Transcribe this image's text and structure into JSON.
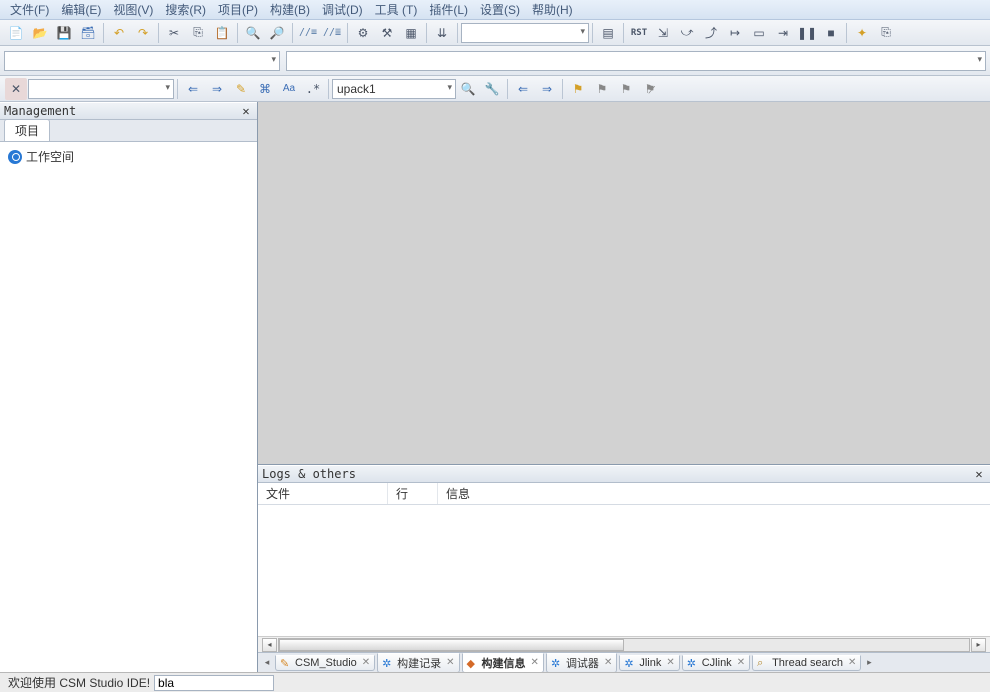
{
  "menubar": [
    "文件(F)",
    "编辑(E)",
    "视图(V)",
    "搜索(R)",
    "项目(P)",
    "构建(B)",
    "调试(D)",
    "工具 (T)",
    "插件(L)",
    "设置(S)",
    "帮助(H)"
  ],
  "search_toolbar": {
    "combo": "",
    "target": "upack1"
  },
  "management": {
    "title": "Management",
    "tab": "项目",
    "root": "工作空间"
  },
  "logs": {
    "title": "Logs & others",
    "columns": [
      "文件",
      "行",
      "信息"
    ]
  },
  "bottom_tabs": [
    {
      "icon": "pencil",
      "label": "CSM_Studio",
      "active": false
    },
    {
      "icon": "gear",
      "label": "构建记录",
      "active": false
    },
    {
      "icon": "flag",
      "label": "构建信息",
      "active": true
    },
    {
      "icon": "gear",
      "label": "调试器",
      "active": false
    },
    {
      "icon": "gear",
      "label": "Jlink",
      "active": false
    },
    {
      "icon": "gear",
      "label": "CJlink",
      "active": false
    },
    {
      "icon": "glass",
      "label": "Thread search",
      "active": false
    }
  ],
  "status": {
    "welcome": "欢迎使用 CSM Studio IDE!",
    "input": "bla"
  }
}
